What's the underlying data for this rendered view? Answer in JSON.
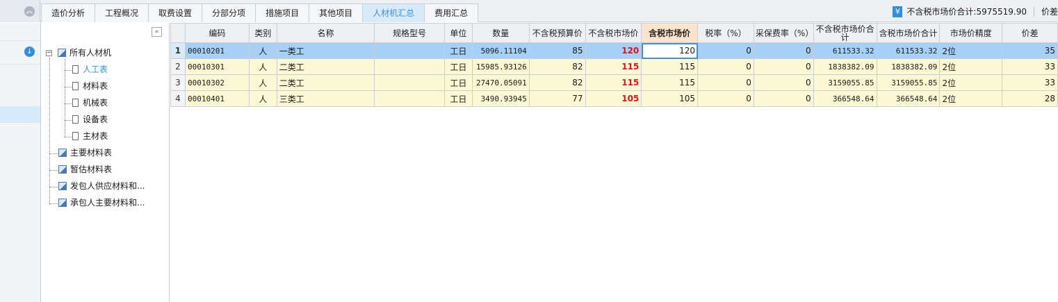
{
  "tabs": [
    {
      "label": "造价分析",
      "active": false
    },
    {
      "label": "工程概况",
      "active": false
    },
    {
      "label": "取费设置",
      "active": false
    },
    {
      "label": "分部分项",
      "active": false
    },
    {
      "label": "措施项目",
      "active": false
    },
    {
      "label": "其他项目",
      "active": false
    },
    {
      "label": "人材机汇总",
      "active": true
    },
    {
      "label": "费用汇总",
      "active": false
    }
  ],
  "summary": {
    "icon": "yen-icon",
    "label": "不含税市场价合计:5975519.90",
    "price_diff_label": "价差"
  },
  "tree": {
    "root": "所有人材机",
    "children": [
      "人工表",
      "材料表",
      "机械表",
      "设备表",
      "主材表"
    ],
    "selected": "人工表",
    "siblings": [
      "主要材料表",
      "暂估材料表",
      "发包人供应材料和...",
      "承包人主要材料和..."
    ]
  },
  "table": {
    "headers": [
      "编码",
      "类别",
      "名称",
      "规格型号",
      "单位",
      "数量",
      "不含税预算价",
      "不含税市场价",
      "含税市场价",
      "税率（%）",
      "采保费率（%）",
      "不含税市场价合计",
      "含税市场价合计",
      "市场价精度",
      "价差"
    ],
    "rows": [
      {
        "num": "1",
        "code": "00010201",
        "type": "人",
        "name": "一类工",
        "spec": "",
        "unit": "工日",
        "qty": "5096.11104",
        "budget": "85",
        "market": "120",
        "market_tax": "120",
        "tax_rate": "0",
        "fee_rate": "0",
        "market_total": "611533.32",
        "market_tax_total": "611533.32",
        "precision": "2位",
        "diff": "35"
      },
      {
        "num": "2",
        "code": "00010301",
        "type": "人",
        "name": "二类工",
        "spec": "",
        "unit": "工日",
        "qty": "15985.93126",
        "budget": "82",
        "market": "115",
        "market_tax": "115",
        "tax_rate": "0",
        "fee_rate": "0",
        "market_total": "1838382.09",
        "market_tax_total": "1838382.09",
        "precision": "2位",
        "diff": "33"
      },
      {
        "num": "3",
        "code": "00010302",
        "type": "人",
        "name": "二类工",
        "spec": "",
        "unit": "工日",
        "qty": "27470.05091",
        "budget": "82",
        "market": "115",
        "market_tax": "115",
        "tax_rate": "0",
        "fee_rate": "0",
        "market_total": "3159055.85",
        "market_tax_total": "3159055.85",
        "precision": "2位",
        "diff": "33"
      },
      {
        "num": "4",
        "code": "00010401",
        "type": "人",
        "name": "三类工",
        "spec": "",
        "unit": "工日",
        "qty": "3490.93945",
        "budget": "77",
        "market": "105",
        "market_tax": "105",
        "tax_rate": "0",
        "fee_rate": "0",
        "market_total": "366548.64",
        "market_tax_total": "366548.64",
        "precision": "2位",
        "diff": "28"
      }
    ]
  },
  "colors": {
    "accent": "#3e8fd6",
    "selected_row": "#a6d0f6",
    "row_bg": "#fdf8d4",
    "market_price": "#e0131a"
  }
}
